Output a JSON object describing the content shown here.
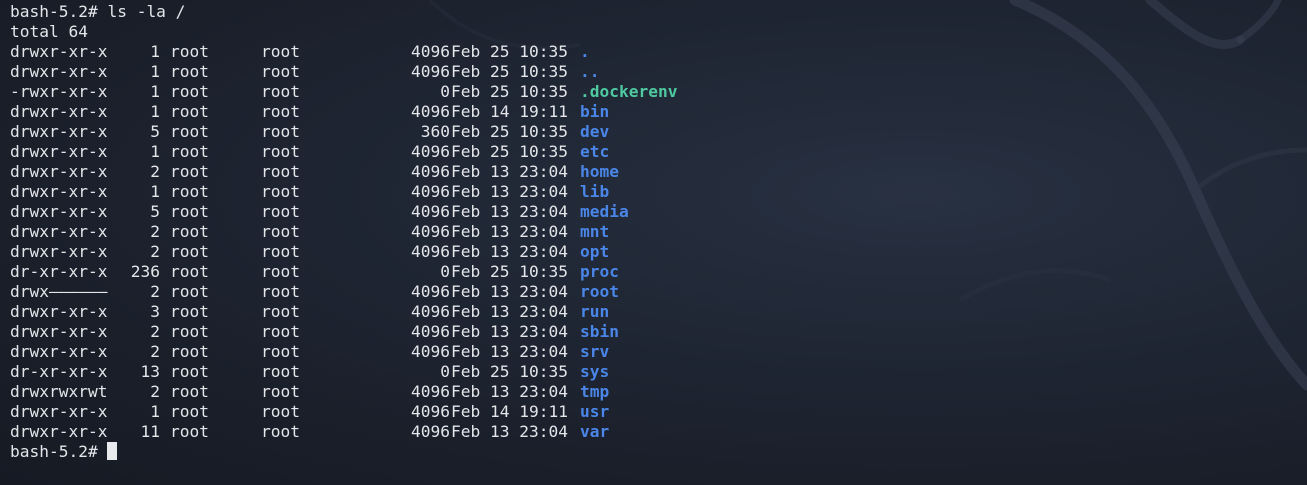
{
  "prompt_line": "bash-5.2# ls -la /",
  "total_line": "total 64",
  "entries": [
    {
      "perms": "drwxr-xr-x",
      "links": "1",
      "owner": "root",
      "group": "root",
      "size": "4096",
      "date": "Feb 25 10:35",
      "name": ".",
      "color": "#4a86e8"
    },
    {
      "perms": "drwxr-xr-x",
      "links": "1",
      "owner": "root",
      "group": "root",
      "size": "4096",
      "date": "Feb 25 10:35",
      "name": "..",
      "color": "#4a86e8"
    },
    {
      "perms": "-rwxr-xr-x",
      "links": "1",
      "owner": "root",
      "group": "root",
      "size": "0",
      "date": "Feb 25 10:35",
      "name": ".dockerenv",
      "color": "#4ec9a0"
    },
    {
      "perms": "drwxr-xr-x",
      "links": "1",
      "owner": "root",
      "group": "root",
      "size": "4096",
      "date": "Feb 14 19:11",
      "name": "bin",
      "color": "#4a86e8"
    },
    {
      "perms": "drwxr-xr-x",
      "links": "5",
      "owner": "root",
      "group": "root",
      "size": "360",
      "date": "Feb 25 10:35",
      "name": "dev",
      "color": "#4a86e8"
    },
    {
      "perms": "drwxr-xr-x",
      "links": "1",
      "owner": "root",
      "group": "root",
      "size": "4096",
      "date": "Feb 25 10:35",
      "name": "etc",
      "color": "#4a86e8"
    },
    {
      "perms": "drwxr-xr-x",
      "links": "2",
      "owner": "root",
      "group": "root",
      "size": "4096",
      "date": "Feb 13 23:04",
      "name": "home",
      "color": "#4a86e8"
    },
    {
      "perms": "drwxr-xr-x",
      "links": "1",
      "owner": "root",
      "group": "root",
      "size": "4096",
      "date": "Feb 13 23:04",
      "name": "lib",
      "color": "#4a86e8"
    },
    {
      "perms": "drwxr-xr-x",
      "links": "5",
      "owner": "root",
      "group": "root",
      "size": "4096",
      "date": "Feb 13 23:04",
      "name": "media",
      "color": "#4a86e8"
    },
    {
      "perms": "drwxr-xr-x",
      "links": "2",
      "owner": "root",
      "group": "root",
      "size": "4096",
      "date": "Feb 13 23:04",
      "name": "mnt",
      "color": "#4a86e8"
    },
    {
      "perms": "drwxr-xr-x",
      "links": "2",
      "owner": "root",
      "group": "root",
      "size": "4096",
      "date": "Feb 13 23:04",
      "name": "opt",
      "color": "#4a86e8"
    },
    {
      "perms": "dr-xr-xr-x",
      "links": "236",
      "owner": "root",
      "group": "root",
      "size": "0",
      "date": "Feb 25 10:35",
      "name": "proc",
      "color": "#4a86e8"
    },
    {
      "perms": "drwx——————",
      "links": "2",
      "owner": "root",
      "group": "root",
      "size": "4096",
      "date": "Feb 13 23:04",
      "name": "root",
      "color": "#4a86e8"
    },
    {
      "perms": "drwxr-xr-x",
      "links": "3",
      "owner": "root",
      "group": "root",
      "size": "4096",
      "date": "Feb 13 23:04",
      "name": "run",
      "color": "#4a86e8"
    },
    {
      "perms": "drwxr-xr-x",
      "links": "2",
      "owner": "root",
      "group": "root",
      "size": "4096",
      "date": "Feb 13 23:04",
      "name": "sbin",
      "color": "#4a86e8"
    },
    {
      "perms": "drwxr-xr-x",
      "links": "2",
      "owner": "root",
      "group": "root",
      "size": "4096",
      "date": "Feb 13 23:04",
      "name": "srv",
      "color": "#4a86e8"
    },
    {
      "perms": "dr-xr-xr-x",
      "links": "13",
      "owner": "root",
      "group": "root",
      "size": "0",
      "date": "Feb 25 10:35",
      "name": "sys",
      "color": "#4a86e8"
    },
    {
      "perms": "drwxrwxrwt",
      "links": "2",
      "owner": "root",
      "group": "root",
      "size": "4096",
      "date": "Feb 13 23:04",
      "name": "tmp",
      "color": "#4a86e8"
    },
    {
      "perms": "drwxr-xr-x",
      "links": "1",
      "owner": "root",
      "group": "root",
      "size": "4096",
      "date": "Feb 14 19:11",
      "name": "usr",
      "color": "#4a86e8"
    },
    {
      "perms": "drwxr-xr-x",
      "links": "11",
      "owner": "root",
      "group": "root",
      "size": "4096",
      "date": "Feb 13 23:04",
      "name": "var",
      "color": "#4a86e8"
    }
  ],
  "final_prompt": "bash-5.2# ",
  "colors": {
    "background": "#1b1f29",
    "foreground": "#e4e6ea",
    "directory": "#4a86e8",
    "executable": "#4ec9a0",
    "cursor": "#e8eaee"
  }
}
